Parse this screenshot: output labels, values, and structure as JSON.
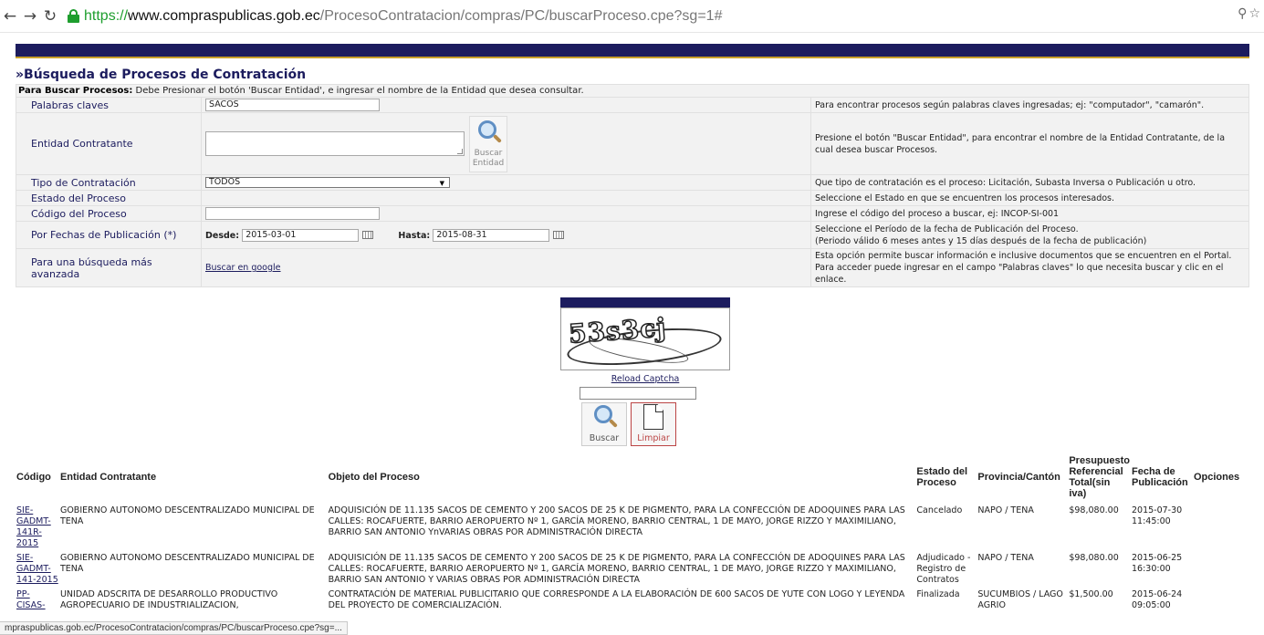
{
  "browser": {
    "url_scheme": "https://",
    "url_host": "www.compraspublicas.gob.ec",
    "url_path": "/ProcesoContratacion/compras/PC/buscarProceso.cpe?sg=1#",
    "status_url": "mpraspublicas.gob.ec/ProcesoContratacion/compras/PC/buscarProceso.cpe?sg=..."
  },
  "page": {
    "title": "»Búsqueda de Procesos de Contratación",
    "instr_bold": "Para Buscar Procesos:",
    "instr_text": " Debe Presionar el botón 'Buscar Entidad', e ingresar el nombre de la Entidad que desea consultar."
  },
  "form": {
    "keywords": {
      "label": "Palabras claves",
      "value": "SACOS",
      "help": "Para encontrar procesos según palabras claves ingresadas; ej: \"computador\", \"camarón\"."
    },
    "entity": {
      "label": "Entidad Contratante",
      "button_line1": "Buscar",
      "button_line2": "Entidad",
      "help": "Presione el botón \"Buscar Entidad\", para encontrar el nombre de la Entidad Contratante, de la cual desea buscar Procesos."
    },
    "type": {
      "label": "Tipo de Contratación",
      "value": "TODOS",
      "help": "Que tipo de contratación es el proceso: Licitación, Subasta Inversa o Publicación u otro."
    },
    "state": {
      "label": "Estado del Proceso",
      "help": "Seleccione el Estado en que se encuentren los procesos interesados."
    },
    "code": {
      "label": "Código del Proceso",
      "value": "",
      "help": "Ingrese el código del proceso a buscar, ej: INCOP-SI-001"
    },
    "dates": {
      "label": "Por Fechas de Publicación (*)",
      "from_label": "Desde:",
      "from_value": "2015-03-01",
      "to_label": "Hasta:",
      "to_value": "2015-08-31",
      "help1": "Seleccione el Período de la fecha de Publicación del Proceso.",
      "help2": "(Periodo válido 6 meses antes y 15 días después de la fecha de publicación)"
    },
    "advanced": {
      "label": "Para una búsqueda más avanzada",
      "link": "Buscar en google",
      "help": "Esta opción permite buscar información e inclusive documentos que se encuentren en el Portal. Para acceder puede ingresar en el campo \"Palabras claves\" lo que necesita buscar y clic en el enlace."
    }
  },
  "captcha": {
    "image_text": "53s3cj",
    "reload_label": "Reload Captcha",
    "search_label": "Buscar",
    "clear_label": "Limpiar"
  },
  "results": {
    "headers": [
      "Código",
      "Entidad Contratante",
      "Objeto del Proceso",
      "Estado del Proceso",
      "Provincia/Cantón",
      "Presupuesto Referencial Total(sin iva)",
      "Fecha de Publicación",
      "Opciones"
    ],
    "rows": [
      {
        "code": "SIE-GADMT-141R-2015",
        "entity": "GOBIERNO AUTONOMO DESCENTRALIZADO MUNICIPAL DE TENA",
        "object": "ADQUISICIÓN DE 11.135 SACOS DE CEMENTO Y 200 SACOS DE 25 K DE PIGMENTO, PARA LA CONFECCIÓN DE ADOQUINES PARA LAS CALLES: ROCAFUERTE, BARRIO AEROPUERTO Nº 1, GARCÍA MORENO, BARRIO CENTRAL, 1 DE MAYO, JORGE RIZZO Y MAXIMILIANO, BARRIO SAN ANTONIO YnVARIAS OBRAS POR ADMINISTRACIÓN DIRECTA",
        "state": "Cancelado",
        "province": "NAPO / TENA",
        "budget": "$98,080.00",
        "date": "2015-07-30 11:45:00"
      },
      {
        "code": "SIE-GADMT-141-2015",
        "entity": "GOBIERNO AUTONOMO DESCENTRALIZADO MUNICIPAL DE TENA",
        "object": "ADQUISICIÓN DE 11.135 SACOS DE CEMENTO Y 200 SACOS DE 25 K DE PIGMENTO, PARA LA CONFECCIÓN DE ADOQUINES PARA LAS CALLES: ROCAFUERTE, BARRIO AEROPUERTO Nº 1, GARCÍA MORENO, BARRIO CENTRAL, 1 DE MAYO, JORGE RIZZO Y MAXIMILIANO, BARRIO SAN ANTONIO Y VARIAS OBRAS POR ADMINISTRACIÓN DIRECTA",
        "state": "Adjudicado - Registro de Contratos",
        "province": "NAPO / TENA",
        "budget": "$98,080.00",
        "date": "2015-06-25 16:30:00"
      },
      {
        "code": "PP-CISAS-",
        "entity": "UNIDAD ADSCRITA DE DESARROLLO PRODUCTIVO AGROPECUARIO DE INDUSTRIALIZACION,",
        "object": "CONTRATACIÓN DE MATERIAL PUBLICITARIO QUE CORRESPONDE A LA ELABORACIÓN DE 600 SACOS DE YUTE CON LOGO Y LEYENDA DEL PROYECTO DE COMERCIALIZACIÓN.",
        "state": "Finalizada",
        "province": "SUCUMBIOS / LAGO AGRIO",
        "budget": "$1,500.00",
        "date": "2015-06-24 09:05:00"
      }
    ]
  },
  "colors": {
    "brand_navy": "#1c1c5e",
    "accent_gold": "#c8a02a",
    "secure_green": "#1e9e2e"
  }
}
